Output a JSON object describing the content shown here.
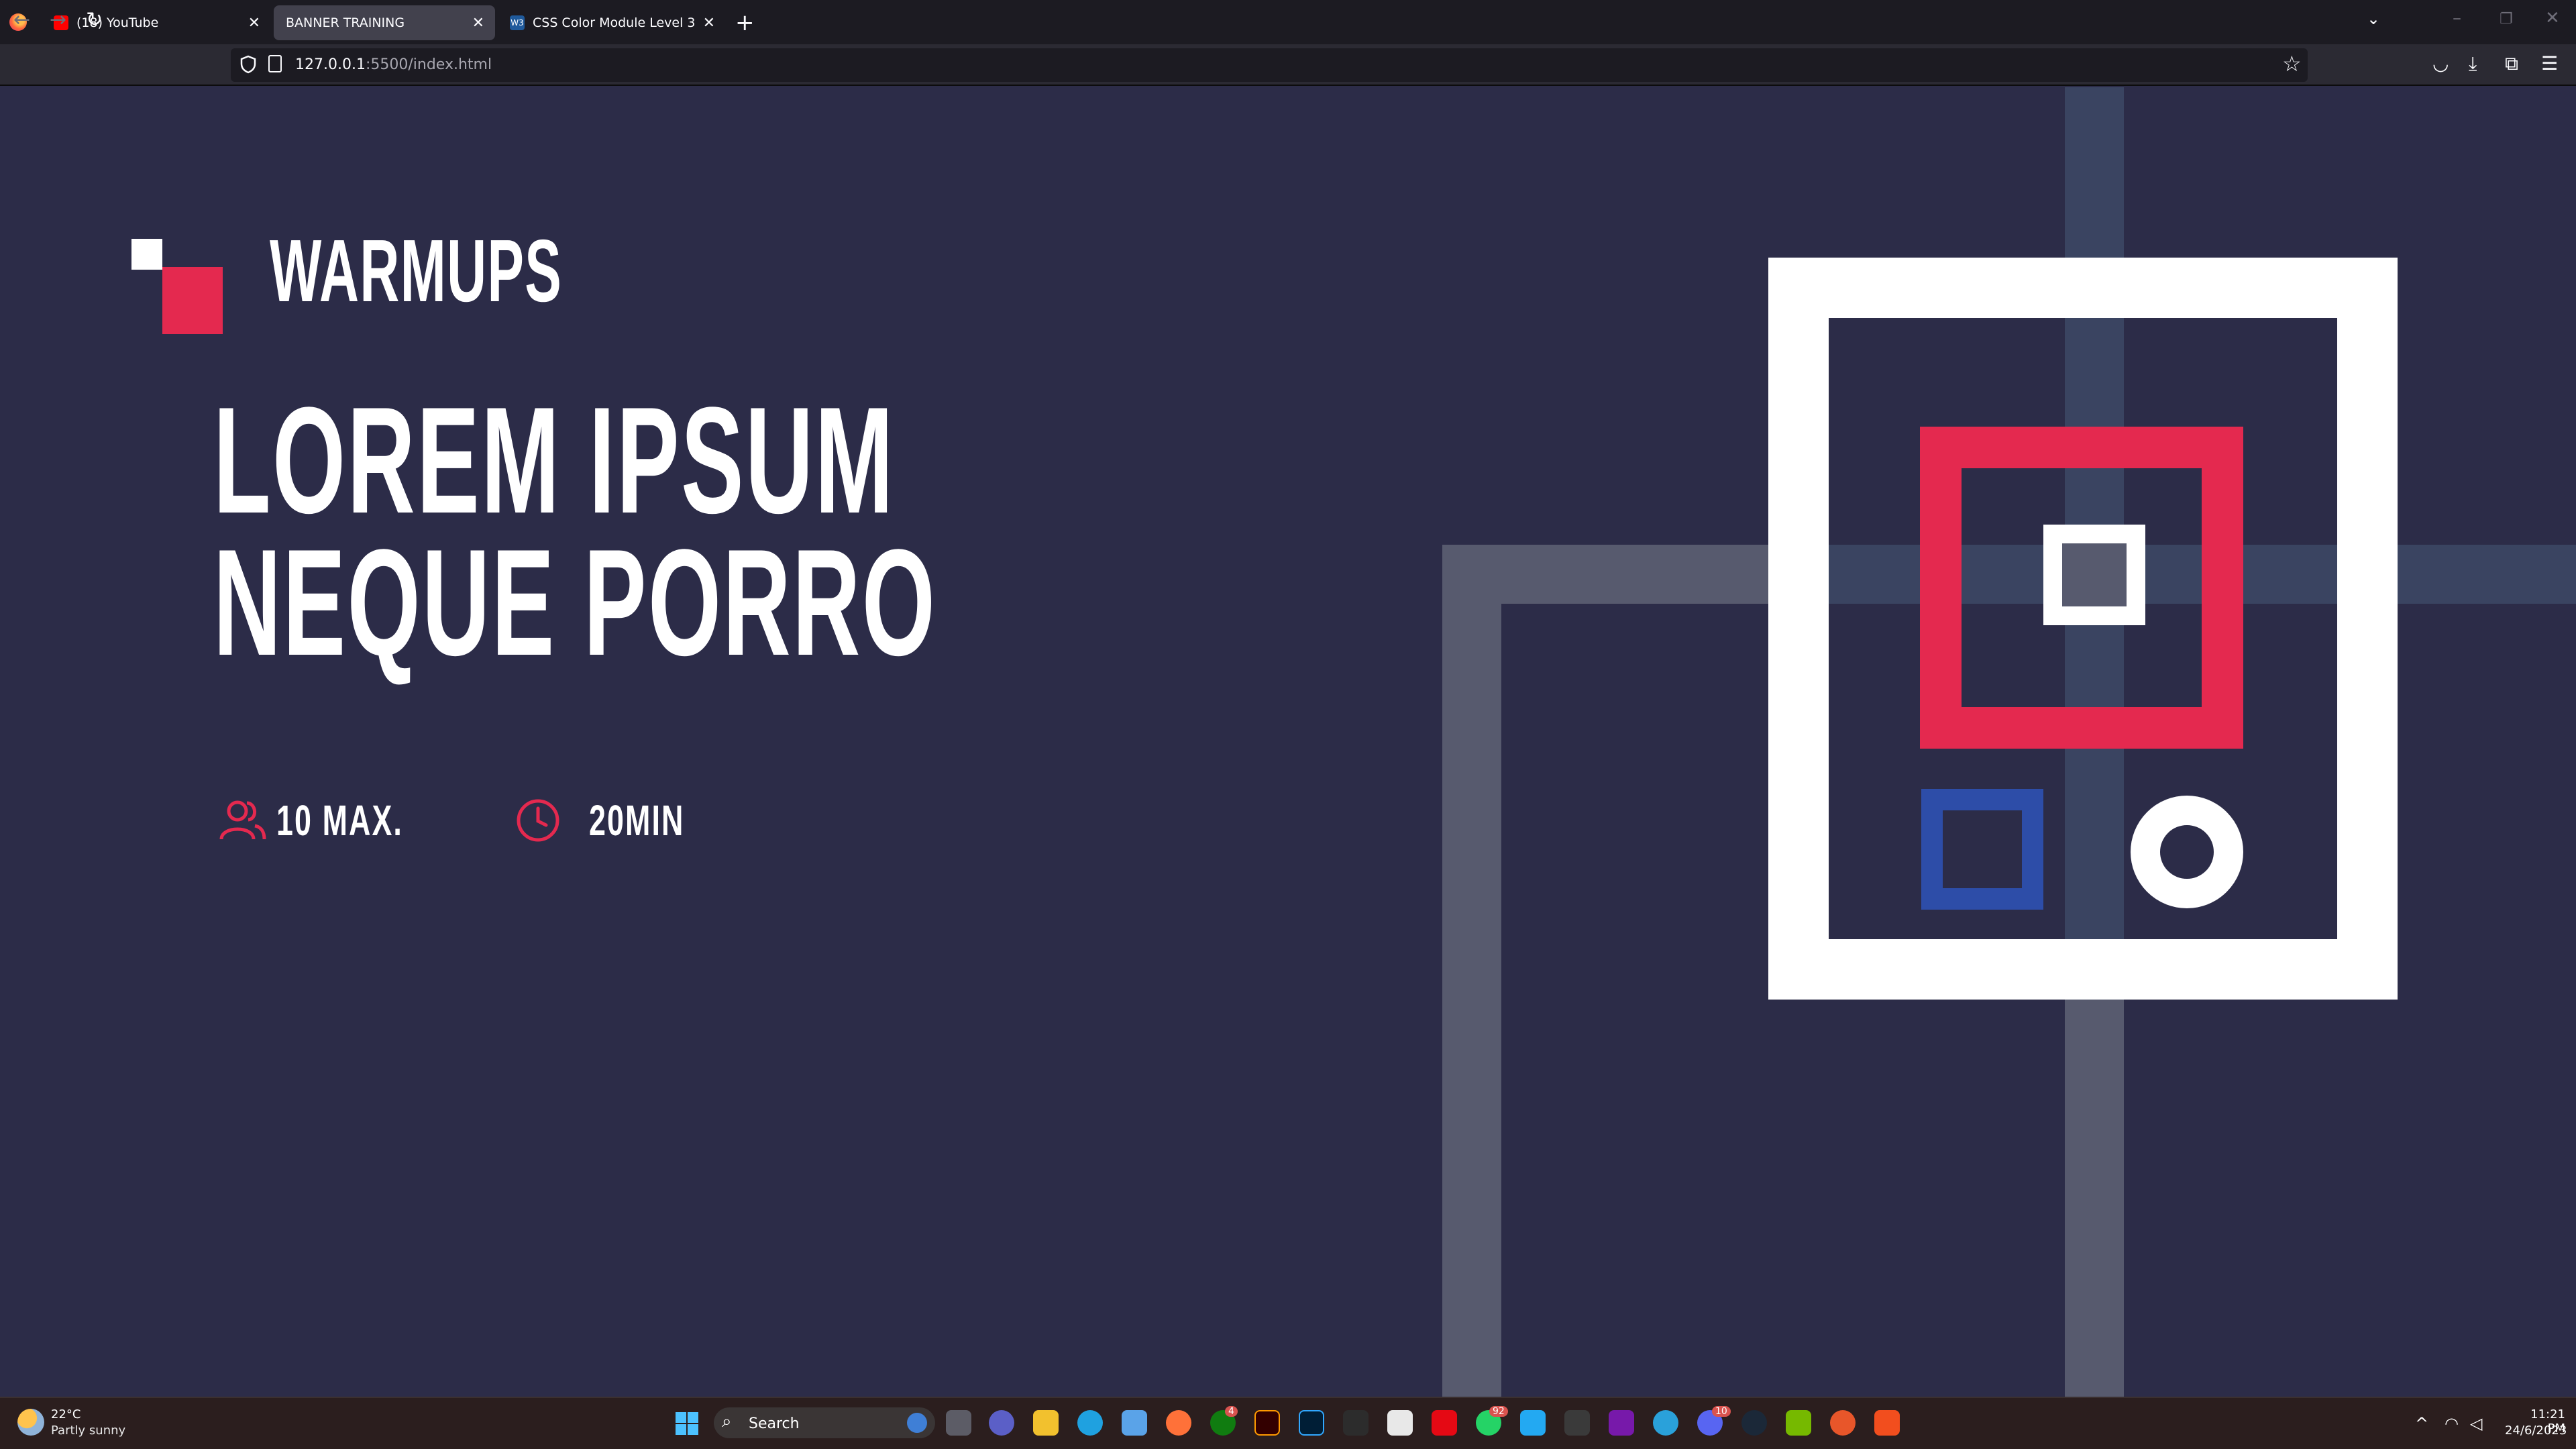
{
  "browser": {
    "tabs": [
      {
        "title": "(18) YouTube",
        "favicon_color": "#ff0000",
        "active": false
      },
      {
        "title": "BANNER TRAINING",
        "favicon_color": "",
        "active": true
      },
      {
        "title": "CSS Color Module Level 3",
        "favicon_color": "#1f5a9c",
        "active": false
      }
    ],
    "new_tab_icon": "plus-icon",
    "url_host": "127.0.0.1",
    "url_rest": ":5500/index.html"
  },
  "page": {
    "brand": "WARMUPS",
    "headline_line1": "LOREM IPSUM",
    "headline_line2": "NEQUE PORRO",
    "participants": "10 MAX.",
    "duration": "20MIN",
    "colors": {
      "background": "#2c2c48",
      "accent_red": "#e4294f",
      "accent_blue": "#2d4da8",
      "white": "#ffffff",
      "stripe_blue": "#3a4461",
      "stripe_grey": "#575a6e"
    }
  },
  "taskbar": {
    "weather_temp": "22°C",
    "weather_desc": "Partly sunny",
    "search_label": "Search",
    "time": "11:21 PM",
    "date": "24/6/2023",
    "badges": {
      "xbox": "4",
      "whatsapp": "92",
      "discord": "10"
    }
  }
}
